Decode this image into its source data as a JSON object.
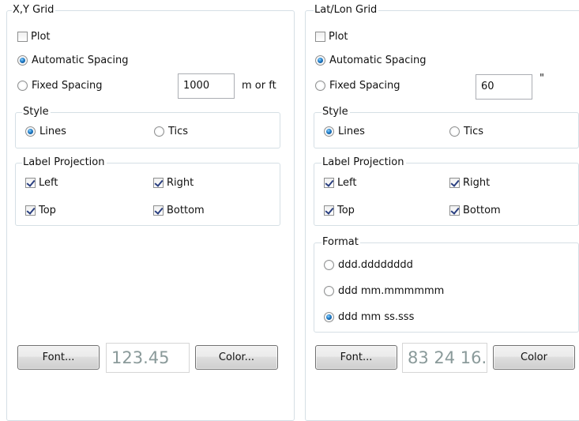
{
  "xy": {
    "title": "X,Y Grid",
    "plot": {
      "label": "Plot",
      "checked": false
    },
    "auto_spacing": {
      "label": "Automatic Spacing",
      "selected": true
    },
    "fixed_spacing": {
      "label": "Fixed Spacing",
      "selected": false
    },
    "spacing_value": "1000",
    "spacing_unit": "m or ft",
    "style": {
      "title": "Style",
      "lines": {
        "label": "Lines",
        "selected": true
      },
      "tics": {
        "label": "Tics",
        "selected": false
      }
    },
    "label_projection": {
      "title": "Label Projection",
      "left": {
        "label": "Left",
        "checked": true
      },
      "right": {
        "label": "Right",
        "checked": true
      },
      "top": {
        "label": "Top",
        "checked": true
      },
      "bottom": {
        "label": "Bottom",
        "checked": true
      }
    },
    "font_button": "Font...",
    "font_preview": "123.45",
    "color_button": "Color..."
  },
  "latlon": {
    "title": "Lat/Lon Grid",
    "plot": {
      "label": "Plot",
      "checked": false
    },
    "auto_spacing": {
      "label": "Automatic Spacing",
      "selected": true
    },
    "fixed_spacing": {
      "label": "Fixed Spacing",
      "selected": false
    },
    "spacing_value": "60",
    "spacing_unit": "\"",
    "style": {
      "title": "Style",
      "lines": {
        "label": "Lines",
        "selected": true
      },
      "tics": {
        "label": "Tics",
        "selected": false
      }
    },
    "label_projection": {
      "title": "Label Projection",
      "left": {
        "label": "Left",
        "checked": true
      },
      "right": {
        "label": "Right",
        "checked": true
      },
      "top": {
        "label": "Top",
        "checked": true
      },
      "bottom": {
        "label": "Bottom",
        "checked": true
      }
    },
    "format": {
      "title": "Format",
      "opt1": {
        "label": "ddd.dddddddd",
        "selected": false
      },
      "opt2": {
        "label": "ddd mm.mmmmmm",
        "selected": false
      },
      "opt3": {
        "label": "ddd mm ss.sss",
        "selected": true
      }
    },
    "font_button": "Font...",
    "font_preview": "83 24 16.",
    "color_button": "Color"
  }
}
